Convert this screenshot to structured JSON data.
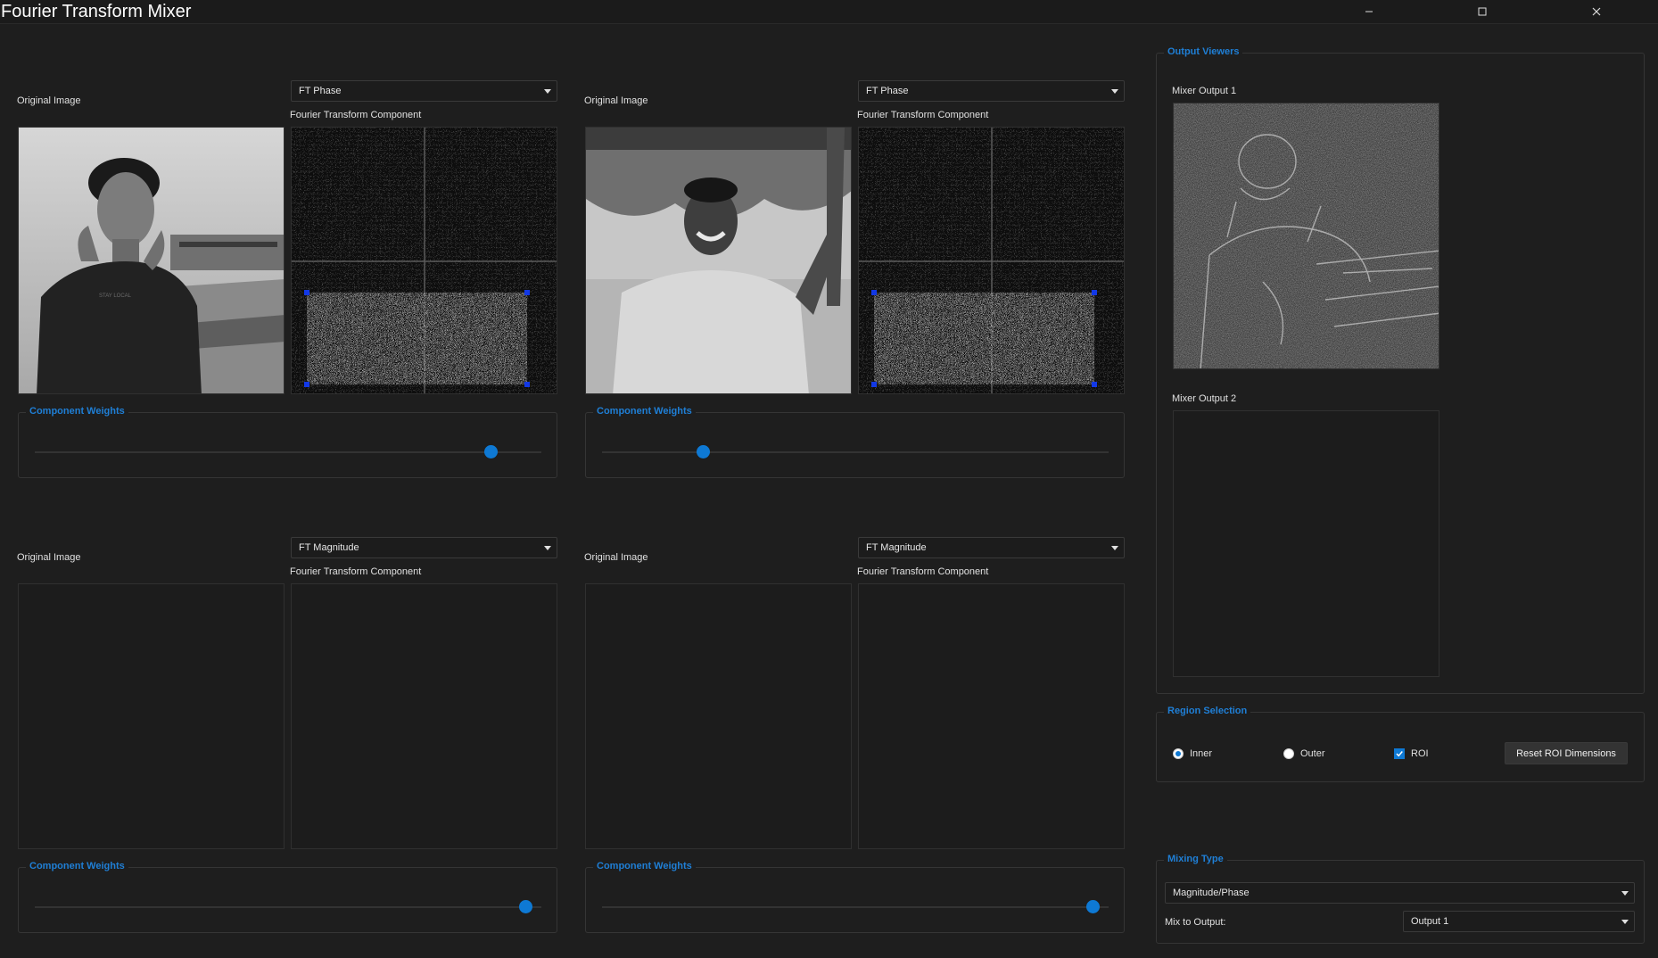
{
  "window": {
    "title": "Fourier Transform Mixer",
    "minimize_icon": "minimize-icon",
    "maximize_icon": "maximize-icon",
    "close_icon": "close-icon"
  },
  "panels": [
    {
      "original_label": "Original Image",
      "component_label": "Fourier Transform Component",
      "component_select": "FT Phase",
      "weights_title": "Component Weights",
      "weight_value": 0.9
    },
    {
      "original_label": "Original Image",
      "component_label": "Fourier Transform Component",
      "component_select": "FT Phase",
      "weights_title": "Component Weights",
      "weight_value": 0.2
    },
    {
      "original_label": "Original Image",
      "component_label": "Fourier Transform Component",
      "component_select": "FT Magnitude",
      "weights_title": "Component Weights",
      "weight_value": 0.97
    },
    {
      "original_label": "Original Image",
      "component_label": "Fourier Transform Component",
      "component_select": "FT Magnitude",
      "weights_title": "Component Weights",
      "weight_value": 0.97
    }
  ],
  "output_viewers": {
    "title": "Output Viewers",
    "output1_label": "Mixer Output 1",
    "output2_label": "Mixer Output 2"
  },
  "region_selection": {
    "title": "Region Selection",
    "inner_label": "Inner",
    "outer_label": "Outer",
    "roi_label": "ROI",
    "selected": "Inner",
    "roi_checked": true,
    "reset_button": "Reset ROI Dimensions"
  },
  "mixing_type": {
    "title": "Mixing Type",
    "mode": "Magnitude/Phase",
    "mix_to_label": "Mix to Output:",
    "output": "Output 1"
  },
  "colors": {
    "accent": "#0e79d4",
    "background": "#1e1e1e",
    "roi_handle": "#1238e6"
  }
}
